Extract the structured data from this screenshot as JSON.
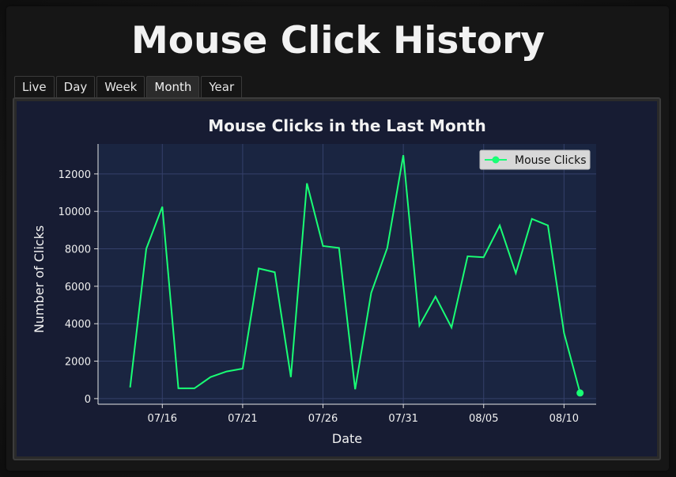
{
  "app": {
    "title": "Mouse Click History"
  },
  "tabs": [
    {
      "label": "Live",
      "active": false
    },
    {
      "label": "Day",
      "active": false
    },
    {
      "label": "Week",
      "active": false
    },
    {
      "label": "Month",
      "active": true
    },
    {
      "label": "Year",
      "active": false
    }
  ],
  "colors": {
    "line": "#19ff75",
    "chart_bg": "#1a2541",
    "figure_bg": "#171c33"
  },
  "chart_data": {
    "type": "line",
    "title": "Mouse Clicks in the Last Month",
    "xlabel": "Date",
    "ylabel": "Number of Clicks",
    "grid": true,
    "legend_position": "top-right",
    "x_ticks": [
      "07/16",
      "07/21",
      "07/26",
      "07/31",
      "08/05",
      "08/10"
    ],
    "x_tick_dates": [
      "2024-07-16",
      "2024-07-21",
      "2024-07-26",
      "2024-07-31",
      "2024-08-05",
      "2024-08-10"
    ],
    "y_ticks": [
      0,
      2000,
      4000,
      6000,
      8000,
      10000,
      12000
    ],
    "xlim": [
      "2024-07-12",
      "2024-08-12"
    ],
    "ylim": [
      -300,
      13600
    ],
    "series": [
      {
        "name": "Mouse Clicks",
        "x": [
          "2024-07-14",
          "2024-07-15",
          "2024-07-16",
          "2024-07-17",
          "2024-07-18",
          "2024-07-19",
          "2024-07-20",
          "2024-07-21",
          "2024-07-22",
          "2024-07-23",
          "2024-07-24",
          "2024-07-25",
          "2024-07-26",
          "2024-07-27",
          "2024-07-28",
          "2024-07-29",
          "2024-07-30",
          "2024-07-31",
          "2024-08-01",
          "2024-08-02",
          "2024-08-03",
          "2024-08-04",
          "2024-08-05",
          "2024-08-06",
          "2024-08-07",
          "2024-08-08",
          "2024-08-09",
          "2024-08-10",
          "2024-08-11"
        ],
        "values": [
          600,
          8000,
          10250,
          550,
          550,
          1150,
          1450,
          1600,
          6950,
          6750,
          1150,
          11500,
          8150,
          8050,
          500,
          5650,
          8050,
          13000,
          3900,
          5450,
          3800,
          7600,
          7550,
          9250,
          6700,
          9600,
          9250,
          3500,
          300
        ],
        "highlight_last": true
      }
    ]
  }
}
